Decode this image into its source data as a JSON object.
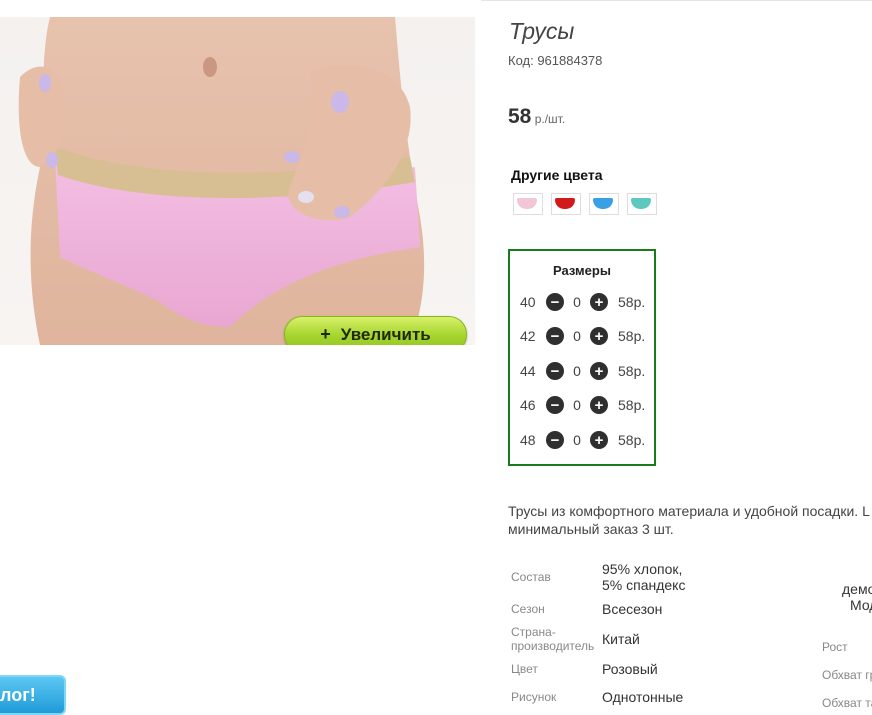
{
  "product": {
    "title": "Трусы",
    "code": "Код: 961884378",
    "price_value": "58",
    "price_unit": " р./шт."
  },
  "zoom": {
    "plus": "+",
    "label": "Увеличить"
  },
  "colors": {
    "heading": "Другие цвета",
    "items": [
      {
        "color": "#f2c6d7"
      },
      {
        "color": "#d21a1a"
      },
      {
        "color": "#3aa0e6"
      },
      {
        "color": "#5cc8c0"
      }
    ]
  },
  "sizes": {
    "title": "Размеры",
    "minus": "−",
    "plus": "+",
    "rows": [
      {
        "size": "40",
        "qty": "0",
        "price": "58р."
      },
      {
        "size": "42",
        "qty": "0",
        "price": "58р."
      },
      {
        "size": "44",
        "qty": "0",
        "price": "58р."
      },
      {
        "size": "46",
        "qty": "0",
        "price": "58р."
      },
      {
        "size": "48",
        "qty": "0",
        "price": "58р."
      }
    ]
  },
  "description": {
    "line1": "Трусы из комфортного материала и удобной посадки. L",
    "line2": "минимальный заказ 3 шт."
  },
  "specs": {
    "sostav_label": "Состав",
    "sostav_value1": "95% хлопок,",
    "sostav_value2": "5% спандекс",
    "sezon_label": "Сезон",
    "sezon_value": "Всесезон",
    "strana_label1": "Страна-",
    "strana_label2": "производитель",
    "strana_value": "Китай",
    "cvet_label": "Цвет",
    "cvet_value": "Розовый",
    "risunok_label": "Рисунок",
    "risunok_value": "Однотонные"
  },
  "right_col": {
    "text1": "демо",
    "text2": "Мод",
    "rost": "Рост",
    "obhvat1": "Обхват гр",
    "obhvat2": "Обхват та"
  },
  "catalog_badge": "лог!"
}
